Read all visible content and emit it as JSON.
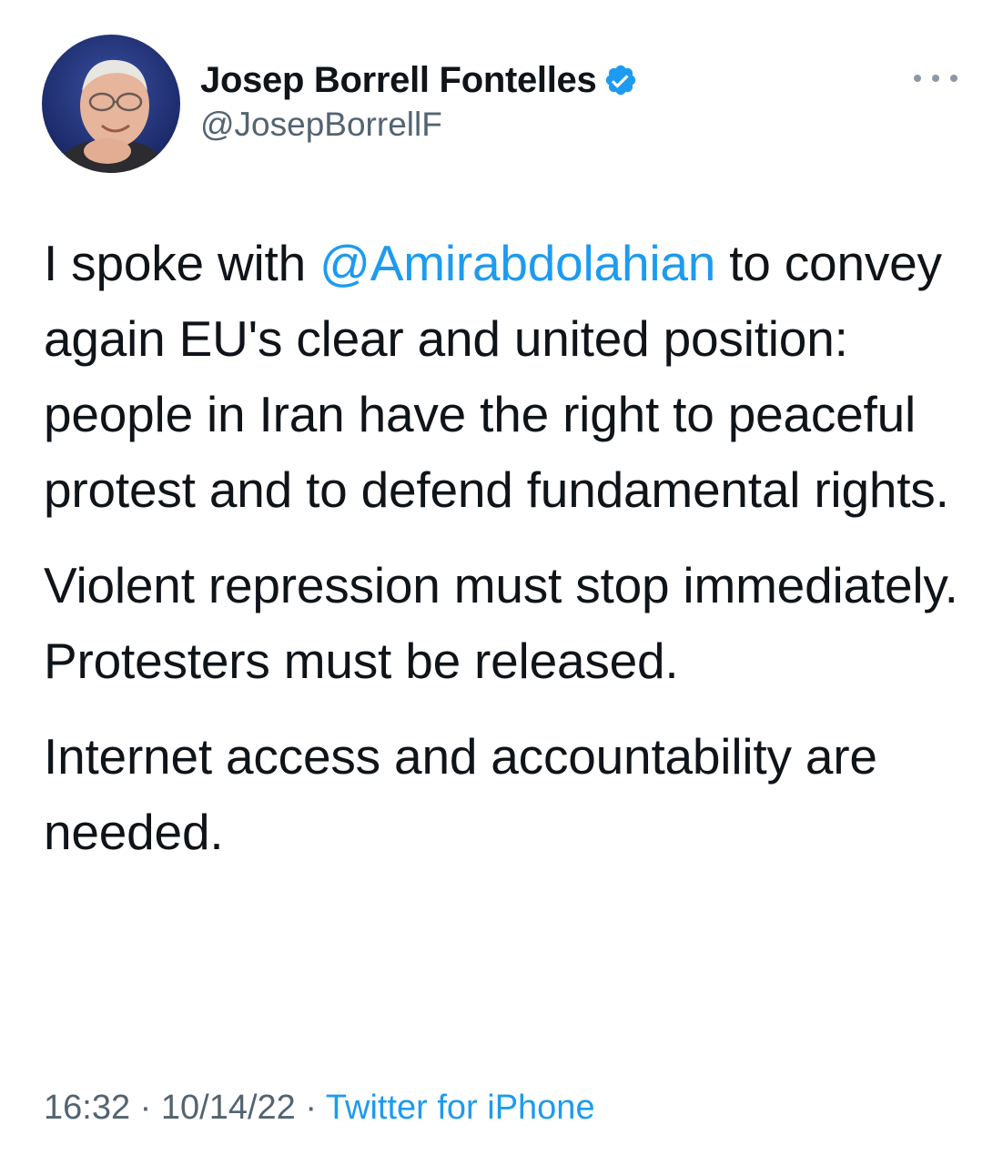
{
  "author": {
    "display_name": "Josep Borrell Fontelles",
    "handle": "@JosepBorrellF",
    "verified": true,
    "avatar_icon": "profile-photo"
  },
  "tweet": {
    "paragraph1": {
      "before": "I spoke with ",
      "mention": "@Amirabdolahian",
      "after": " to convey again EU's clear and united position: people in Iran have the right to peaceful protest and to defend fundamental rights."
    },
    "paragraph2": "Violent repression must stop immediately. Protesters must be released.",
    "paragraph3": "Internet access and accountability are needed."
  },
  "meta": {
    "time": "16:32",
    "separator": " · ",
    "date": "10/14/22",
    "source": "Twitter for iPhone"
  },
  "icons": {
    "more": "more-horizontal-icon",
    "verified": "verified-badge-icon"
  },
  "colors": {
    "accent": "#1d9bf0",
    "text": "#0f1419",
    "secondary": "#536471"
  }
}
